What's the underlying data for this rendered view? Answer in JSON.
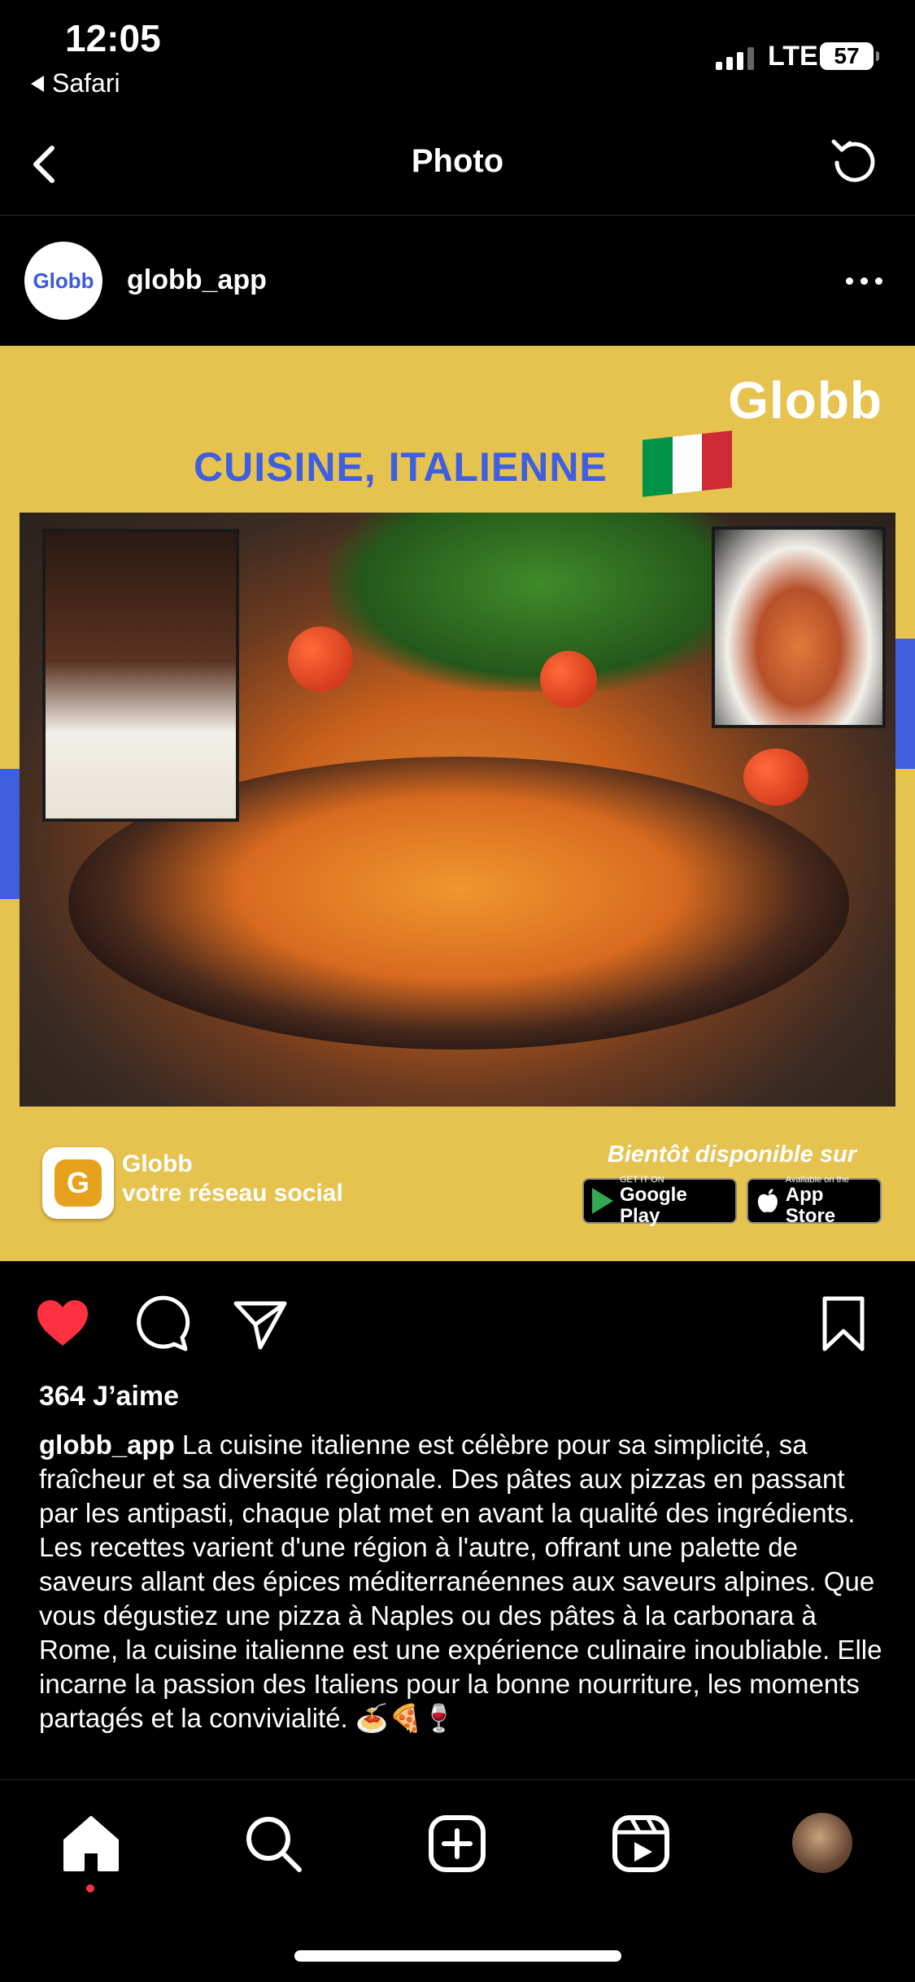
{
  "status_bar": {
    "time": "12:05",
    "back_app": "Safari",
    "network": "LTE",
    "battery": "57"
  },
  "nav": {
    "title": "Photo"
  },
  "post": {
    "username": "globb_app",
    "avatar_text": "Globb",
    "image": {
      "brand": "Globb",
      "headline": "CUISINE, ITALIENNE",
      "app_name": "Globb",
      "app_tagline": "votre réseau social",
      "coming_soon": "Bientôt disponible sur",
      "google_play_small": "GET IT ON",
      "google_play_big": "Google Play",
      "app_store_small": "Available on the",
      "app_store_big": "App Store",
      "flag_colors": [
        "#009246",
        "#ffffff",
        "#ce2b37"
      ]
    },
    "likes": "364 J’aime",
    "caption_user": "globb_app",
    "caption_text": "La cuisine italienne est célèbre pour sa simplicité, sa fraîcheur et sa diversité régionale. Des pâtes aux pizzas en passant par les antipasti, chaque plat met en avant la qualité des ingrédients. Les recettes varient d'une région à l'autre, offrant une palette de saveurs allant des épices méditerranéennes aux saveurs alpines. Que vous dégustiez une pizza à Naples ou des pâtes à la carbonara à Rome, la cuisine italienne est une expérience culinaire inoubliable. Elle incarne la passion des Italiens pour la bonne nourriture, les moments partagés et la convivialité. 🍝🍕🍷",
    "liked": true
  },
  "colors": {
    "like_red": "#ff3040",
    "brand_yellow": "#e6c24f",
    "brand_blue": "#3d5fe0"
  },
  "tabbar": {
    "items": [
      "home-icon",
      "search-icon",
      "create-icon",
      "reels-icon",
      "profile-avatar"
    ],
    "active": "home-icon"
  }
}
